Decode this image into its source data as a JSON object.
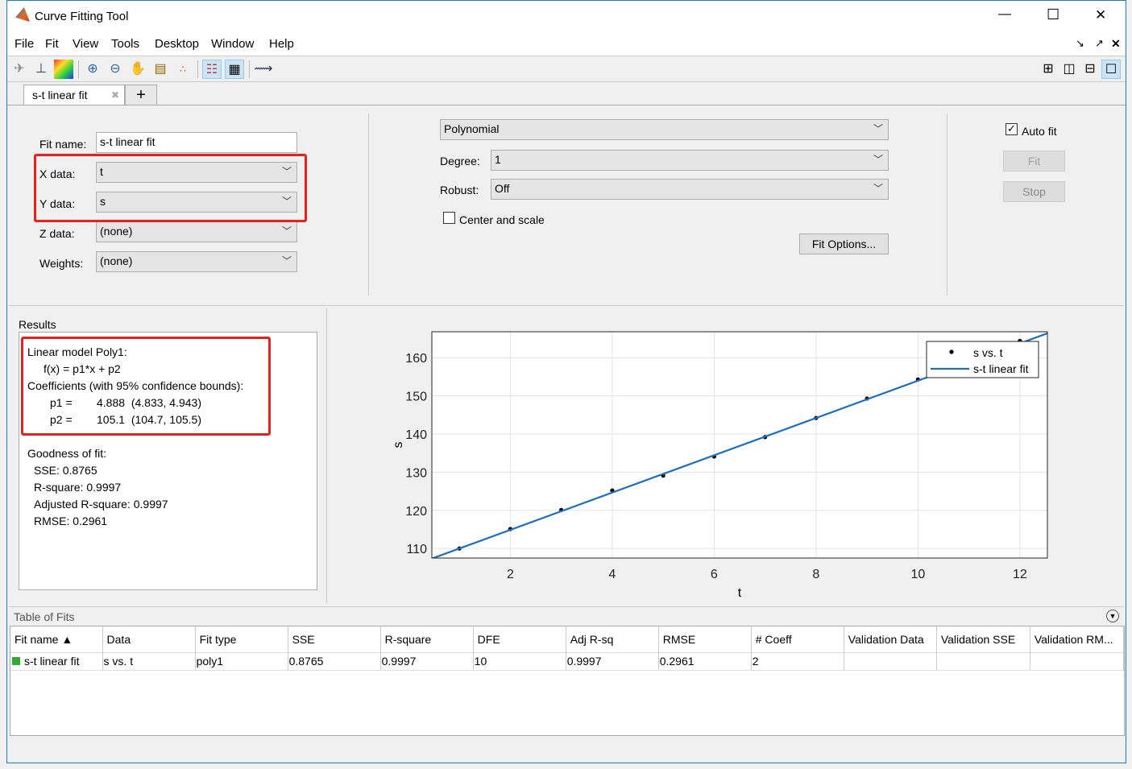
{
  "window": {
    "title": "Curve Fitting Tool",
    "min": "—",
    "max": "☐",
    "close": "✕"
  },
  "menu": [
    "File",
    "Fit",
    "View",
    "Tools",
    "Desktop",
    "Window",
    "Help"
  ],
  "tabs": [
    {
      "label": "s-t linear fit",
      "close": "✖"
    }
  ],
  "add_tab": "+",
  "fit": {
    "name_label": "Fit name:",
    "name_value": "s-t linear fit",
    "x_label": "X data:",
    "x_value": "t",
    "y_label": "Y data:",
    "y_value": "s",
    "z_label": "Z data:",
    "z_value": "(none)",
    "w_label": "Weights:",
    "w_value": "(none)"
  },
  "model": {
    "type": "Polynomial",
    "degree_label": "Degree:",
    "degree": "1",
    "robust_label": "Robust:",
    "robust": "Off",
    "center_label": "Center and scale",
    "center_checked": false,
    "fit_options": "Fit Options..."
  },
  "controls": {
    "auto_fit": "Auto fit",
    "auto_fit_checked": true,
    "fit": "Fit",
    "stop": "Stop"
  },
  "results": {
    "title": "Results",
    "lines": [
      "Linear model Poly1:",
      "f(x) = p1*x + p2",
      "Coefficients (with 95% confidence bounds):"
    ],
    "coeffs": [
      {
        "name": "p1 =",
        "value": "4.888",
        "bounds": "(4.833, 4.943)"
      },
      {
        "name": "p2 =",
        "value": "105.1",
        "bounds": "(104.7, 105.5)"
      }
    ],
    "gof_title": "Goodness of fit:",
    "gof": [
      "SSE: 0.8765",
      "R-square: 0.9997",
      "Adjusted R-square: 0.9997",
      "RMSE: 0.2961"
    ]
  },
  "chart_data": {
    "type": "scatter",
    "xlabel": "t",
    "ylabel": "s",
    "xlim": [
      0.46,
      12.54
    ],
    "ylim": [
      107.5,
      166.8
    ],
    "xticks": [
      2,
      4,
      6,
      8,
      10,
      12
    ],
    "yticks": [
      110,
      120,
      130,
      140,
      150,
      160
    ],
    "grid": true,
    "legend_position": "top-right",
    "series": [
      {
        "name": "s vs. t",
        "kind": "points",
        "x": [
          1,
          2,
          3,
          4,
          5,
          6,
          7,
          8,
          9,
          10,
          11,
          12
        ],
        "y": [
          110.0,
          115.1,
          120.1,
          125.2,
          129.1,
          134.1,
          139.2,
          144.2,
          149.3,
          154.3,
          158.9,
          164.4
        ]
      },
      {
        "name": "s-t linear fit",
        "kind": "line",
        "slope": 4.888,
        "intercept": 105.1,
        "color": "#1f6fbf"
      }
    ]
  },
  "table": {
    "title": "Table of Fits",
    "columns": [
      "Fit name ▲",
      "Data",
      "Fit type",
      "SSE",
      "R-square",
      "DFE",
      "Adj R-sq",
      "RMSE",
      "# Coeff",
      "Validation Data",
      "Validation SSE",
      "Validation RM..."
    ],
    "rows": [
      [
        "s-t linear fit",
        "s vs. t",
        "poly1",
        "0.8765",
        "0.9997",
        "10",
        "0.9997",
        "0.2961",
        "2",
        "",
        "",
        ""
      ]
    ]
  }
}
